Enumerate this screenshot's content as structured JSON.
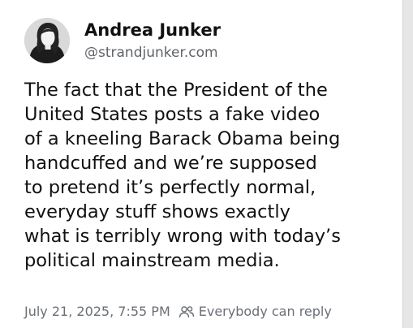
{
  "post": {
    "author": {
      "name": "Andrea Junker",
      "handle": "@strandjunker.com",
      "avatar_icon": "profile-photo"
    },
    "text_lines": [
      "The fact that the President of the",
      "United States posts a fake video",
      "of a kneeling Barack Obama being",
      "handcuffed and we’re supposed",
      "to pretend it’s perfectly normal,",
      "everyday stuff shows exactly",
      "what is terribly wrong with today’s",
      "political mainstream media."
    ],
    "timestamp": "July 21, 2025, 7:55 PM",
    "reply_setting": "Everybody can reply",
    "reply_icon": "people-icon"
  },
  "colors": {
    "background": "#ffffff",
    "text_primary": "#111111",
    "text_secondary": "#6b6f75"
  }
}
